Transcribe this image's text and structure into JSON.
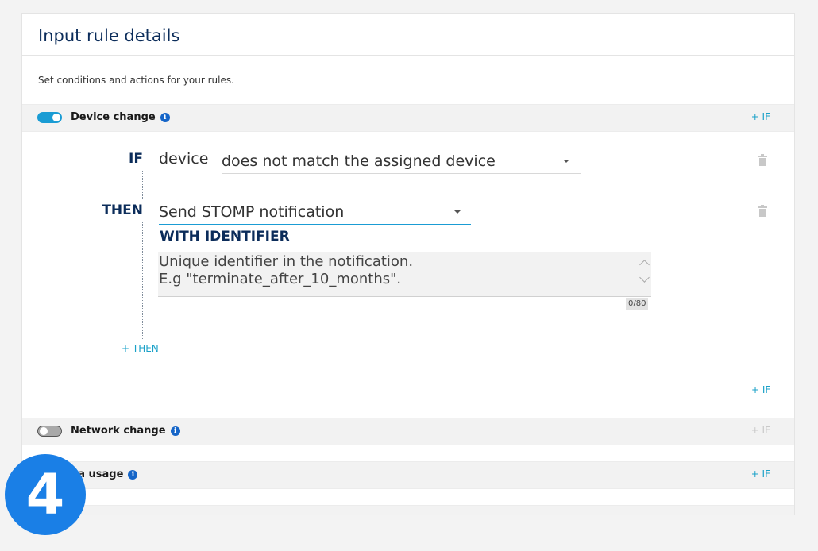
{
  "card": {
    "title": "Input rule details",
    "description": "Set conditions and actions for your rules."
  },
  "sections": [
    {
      "name": "Device change",
      "enabled": true,
      "add_if_label": "+ IF",
      "add_if_enabled": true
    },
    {
      "name": "Network change",
      "enabled": false,
      "add_if_label": "+ IF",
      "add_if_enabled": false
    },
    {
      "name": "ta usage",
      "enabled": true,
      "add_if_label": "+ IF",
      "add_if_enabled": true
    }
  ],
  "rule": {
    "if_keyword": "IF",
    "condition_field": "device",
    "condition_value": "does not match the assigned device",
    "then_keyword": "THEN",
    "action_value": "Send STOMP notification",
    "with_label": "WITH IDENTIFIER",
    "identifier_placeholder_line1": "Unique identifier in the notification.",
    "identifier_placeholder_line2": "E.g \"terminate_after_10_months\".",
    "char_counter": "0/80",
    "add_then_label": "+ THEN",
    "add_if_bottom_label": "+ IF"
  },
  "info_icon_glyph": "i",
  "step_badge": "4",
  "colors": {
    "accent": "#1a9cd4",
    "heading": "#0b2c5a",
    "badge": "#1a7fe6",
    "info_icon": "#1565c8"
  }
}
